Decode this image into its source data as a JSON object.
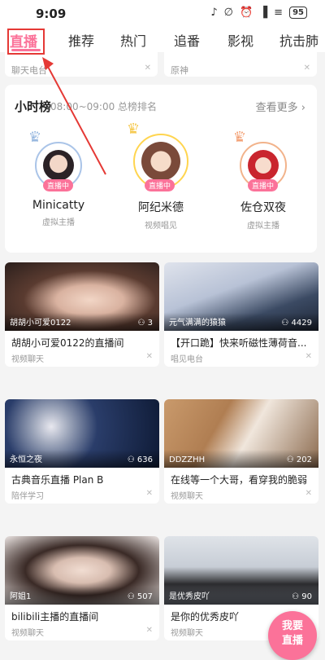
{
  "status_bar": {
    "time": "9:09",
    "battery": "95"
  },
  "tabs": [
    "直播",
    "推荐",
    "热门",
    "追番",
    "影视",
    "抗击肺"
  ],
  "top_peek": [
    {
      "sub": "聊天电台"
    },
    {
      "sub": "原神"
    }
  ],
  "hourly_rank": {
    "title": "小时榜",
    "time": "08:00~09:00 总榜排名",
    "more": "查看更多",
    "streamers": [
      {
        "rank": "2",
        "live": "直播中",
        "name": "Minicatty",
        "category": "虚拟主播"
      },
      {
        "rank": "1",
        "live": "直播中",
        "name": "阿纪米德",
        "category": "视频唱见"
      },
      {
        "rank": "3",
        "live": "直播中",
        "name": "佐仓双夜",
        "category": "虚拟主播"
      }
    ]
  },
  "rooms": [
    {
      "user": "胡胡小可爱0122",
      "views": "3",
      "title": "胡胡小可爱0122的直播间",
      "category": "视频聊天"
    },
    {
      "user": "元气满满的猿猿",
      "views": "4429",
      "title": "【开口跪】快来听磁性薄荷音...",
      "category": "唱见电台"
    },
    {
      "user": "永恒之夜",
      "views": "636",
      "title": "古典音乐直播 Plan B",
      "category": "陪伴学习"
    },
    {
      "user": "DDZZHH",
      "views": "202",
      "title": "在线等一个大哥，看穿我的脆弱",
      "category": "视频聊天"
    },
    {
      "user": "阿姐1",
      "views": "507",
      "title": "bilibili主播的直播间",
      "category": "视频聊天"
    },
    {
      "user": "是优秀皮吖",
      "views": "90",
      "title": "是你的优秀皮吖",
      "category": "视频聊天"
    }
  ],
  "fab": {
    "line1": "我要",
    "line2": "直播"
  },
  "colors": {
    "accent": "#fb7299",
    "annotation": "#e53935"
  }
}
